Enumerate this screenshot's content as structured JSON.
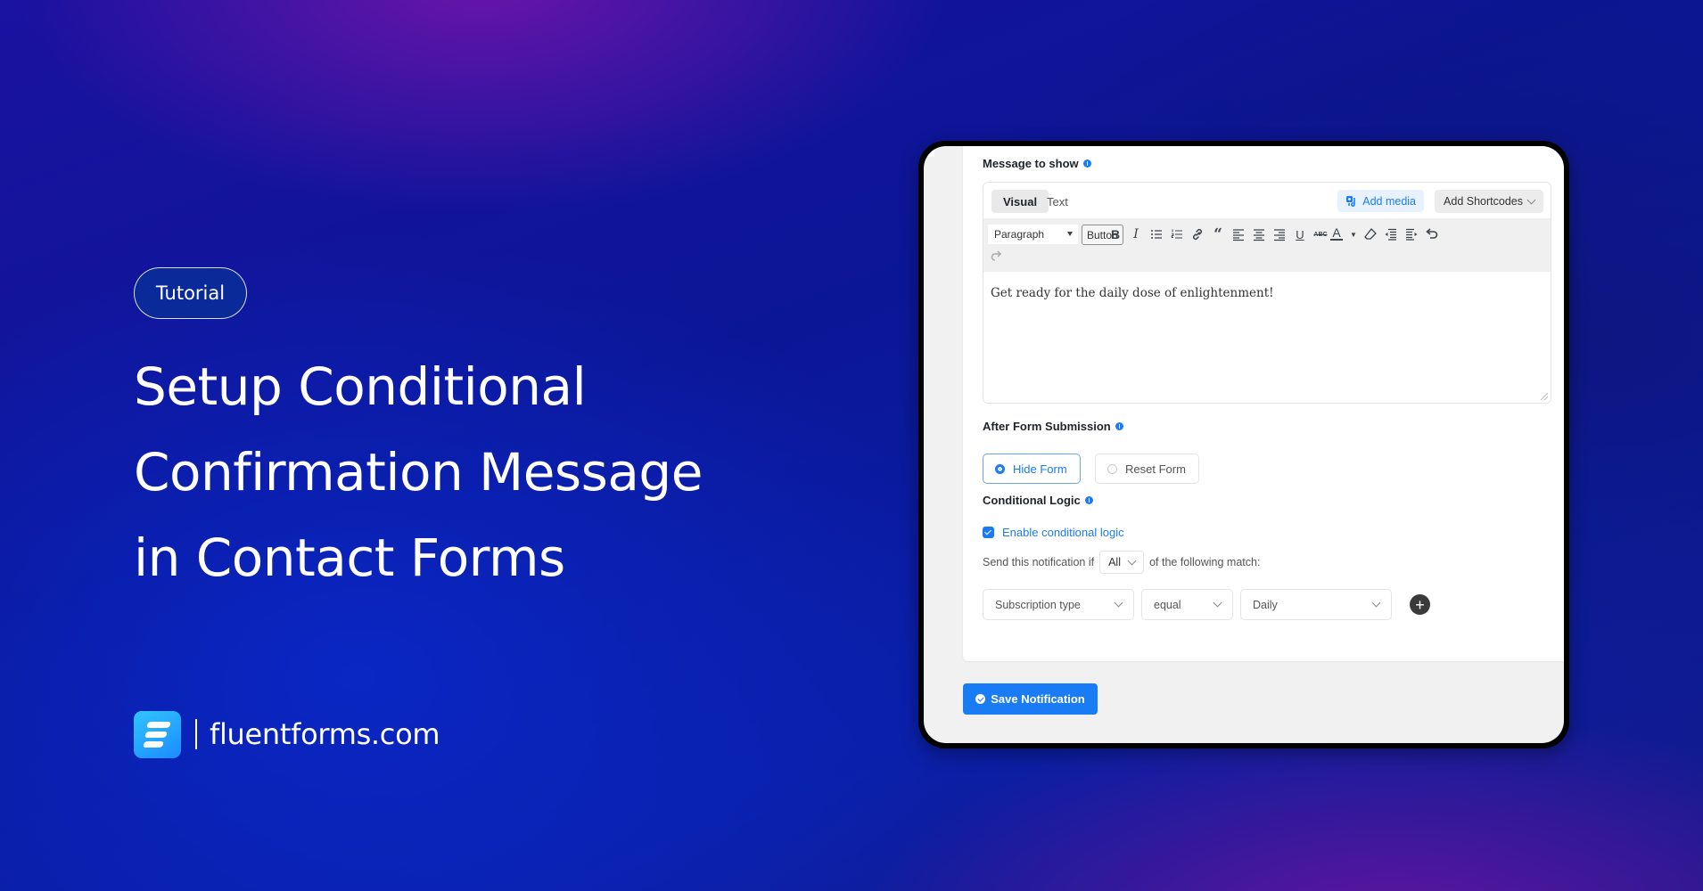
{
  "hero": {
    "badge": "Tutorial",
    "title_lines": [
      "Setup Conditional",
      "Confirmation Message",
      "in Contact Forms"
    ],
    "brand_name": "fluentforms.com",
    "brand_logo_icon": "fluentforms-logo-icon"
  },
  "colors": {
    "accent": "#1a7cf5",
    "brand_logo": "#1a8bff",
    "background_primary": "#0b1696",
    "background_glow": "#6e14aa"
  },
  "form": {
    "message_label": "Message to show",
    "editor": {
      "tabs": [
        {
          "label": "Visual",
          "active": true
        },
        {
          "label": "Text",
          "active": false
        }
      ],
      "add_media_label": "Add media",
      "add_shortcodes_label": "Add Shortcodes",
      "format_select": "Paragraph",
      "button_label": "Button",
      "toolbar_icons": [
        "bold-icon",
        "italic-icon",
        "bullet-list-icon",
        "numbered-list-icon",
        "link-icon",
        "blockquote-icon",
        "align-left-icon",
        "align-center-icon",
        "align-right-icon",
        "underline-icon",
        "strikethrough-icon",
        "text-color-icon",
        "text-color-dropdown-icon",
        "clear-formatting-icon",
        "outdent-icon",
        "indent-icon",
        "undo-icon",
        "redo-icon"
      ],
      "content": "Get ready for the daily dose of enlightenment!"
    },
    "after_submission": {
      "label": "After Form Submission",
      "options": [
        {
          "label": "Hide Form",
          "selected": true
        },
        {
          "label": "Reset Form",
          "selected": false
        }
      ]
    },
    "conditional_logic": {
      "label": "Conditional Logic",
      "enable_label": "Enable conditional logic",
      "enabled": true,
      "send_prefix": "Send this notification if",
      "match_type": "All",
      "send_suffix": "of the following match:",
      "rule": {
        "field": "Subscription type",
        "operator": "equal",
        "value": "Daily"
      },
      "add_rule_symbol": "+"
    },
    "save_label": "Save Notification"
  }
}
